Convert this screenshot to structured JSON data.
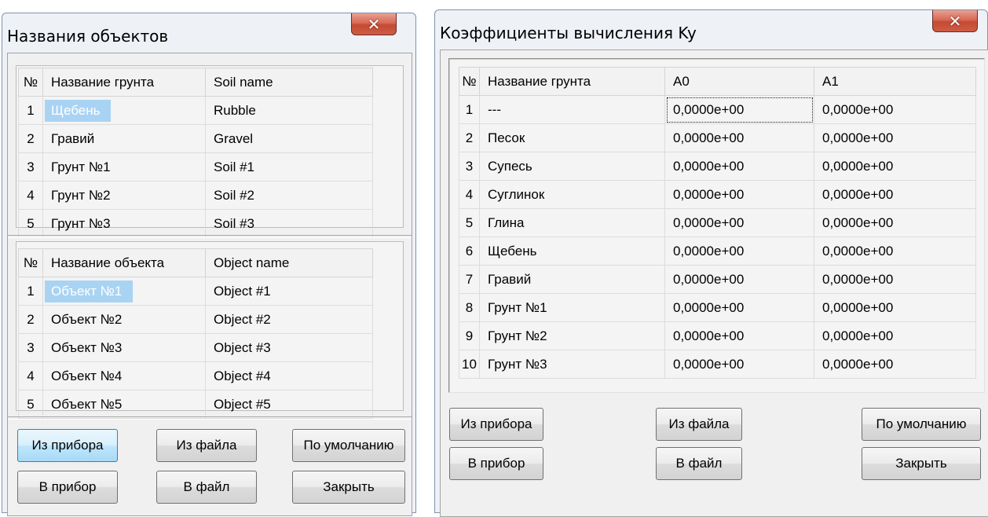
{
  "left_window": {
    "title": "Названия объектов",
    "close_glyph": "✕",
    "soil_table": {
      "headers": [
        "№",
        "Название грунта",
        "Soil name"
      ],
      "rows": [
        [
          "1",
          "Щебень",
          "Rubble"
        ],
        [
          "2",
          "Гравий",
          "Gravel"
        ],
        [
          "3",
          "Грунт №1",
          "Soil #1"
        ],
        [
          "4",
          "Грунт №2",
          "Soil #2"
        ],
        [
          "5",
          "Грунт №3",
          "Soil #3"
        ]
      ]
    },
    "object_table": {
      "headers": [
        "№",
        "Название объекта",
        "Object name"
      ],
      "rows": [
        [
          "1",
          "Объект №1",
          "Object #1"
        ],
        [
          "2",
          "Объект №2",
          "Object #2"
        ],
        [
          "3",
          "Объект №3",
          "Object #3"
        ],
        [
          "4",
          "Объект №4",
          "Object #4"
        ],
        [
          "5",
          "Объект №5",
          "Object #5"
        ]
      ]
    },
    "buttons": {
      "from_device": "Из прибора",
      "from_file": "Из файла",
      "default": "По умолчанию",
      "to_device": "В прибор",
      "to_file": "В файл",
      "close": "Закрыть"
    }
  },
  "right_window": {
    "title": "Коэффициенты вычисления Ky",
    "close_glyph": "✕",
    "table": {
      "headers": [
        "№",
        "Название грунта",
        "A0",
        "A1"
      ],
      "rows": [
        [
          "1",
          "---",
          "0,0000e+00",
          "0,0000e+00"
        ],
        [
          "2",
          "Песок",
          "0,0000e+00",
          "0,0000e+00"
        ],
        [
          "3",
          "Супесь",
          "0,0000e+00",
          "0,0000e+00"
        ],
        [
          "4",
          "Суглинок",
          "0,0000e+00",
          "0,0000e+00"
        ],
        [
          "5",
          "Глина",
          "0,0000e+00",
          "0,0000e+00"
        ],
        [
          "6",
          "Щебень",
          "0,0000e+00",
          "0,0000e+00"
        ],
        [
          "7",
          "Гравий",
          "0,0000e+00",
          "0,0000e+00"
        ],
        [
          "8",
          "Грунт №1",
          "0,0000e+00",
          "0,0000e+00"
        ],
        [
          "9",
          "Грунт №2",
          "0,0000e+00",
          "0,0000e+00"
        ],
        [
          "10",
          "Грунт №3",
          "0,0000e+00",
          "0,0000e+00"
        ]
      ]
    },
    "buttons": {
      "from_device": "Из прибора",
      "from_file": "Из файла",
      "default": "По умолчанию",
      "to_device": "В прибор",
      "to_file": "В файл",
      "close": "Закрыть"
    }
  },
  "colors": {
    "selection": "#a9d3f3",
    "close_button": "#c44a33",
    "window_frame": "#eef1f6"
  }
}
